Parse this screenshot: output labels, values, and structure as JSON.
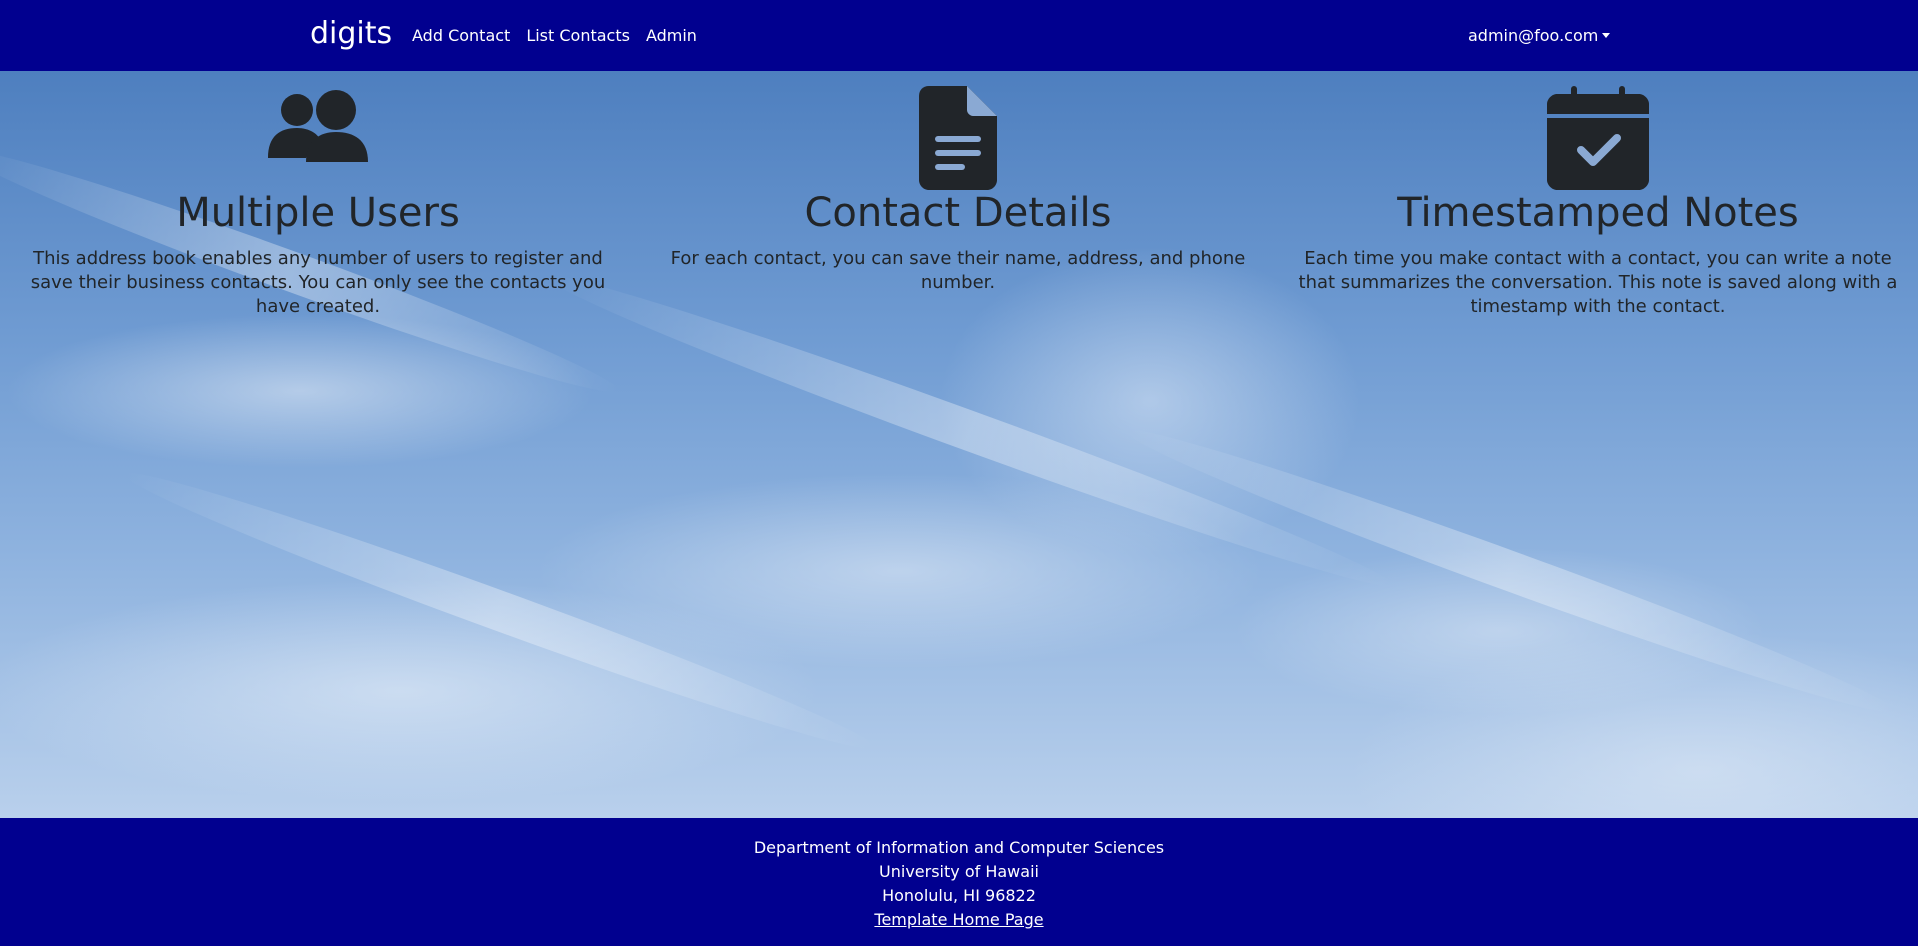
{
  "navbar": {
    "brand": "digits",
    "links": [
      "Add Contact",
      "List Contacts",
      "Admin"
    ],
    "user_menu": "admin@foo.com",
    "background": "#01008f"
  },
  "features": [
    {
      "icon": "users-icon",
      "title": "Multiple Users",
      "text": "This address book enables any number of users to register and save their business contacts. You can only see the contacts you have created."
    },
    {
      "icon": "file-text-icon",
      "title": "Contact Details",
      "text": "For each contact, you can save their name, address, and phone number."
    },
    {
      "icon": "calendar-check-icon",
      "title": "Timestamped Notes",
      "text": "Each time you make contact with a contact, you can write a note that summarizes the conversation. This note is saved along with a timestamp with the contact."
    }
  ],
  "footer": {
    "lines": [
      "Department of Information and Computer Sciences",
      "University of Hawaii",
      "Honolulu, HI 96822"
    ],
    "link": "Template Home Page",
    "background": "#01008f"
  },
  "colors": {
    "icon": "#212529",
    "text": "#212529"
  }
}
